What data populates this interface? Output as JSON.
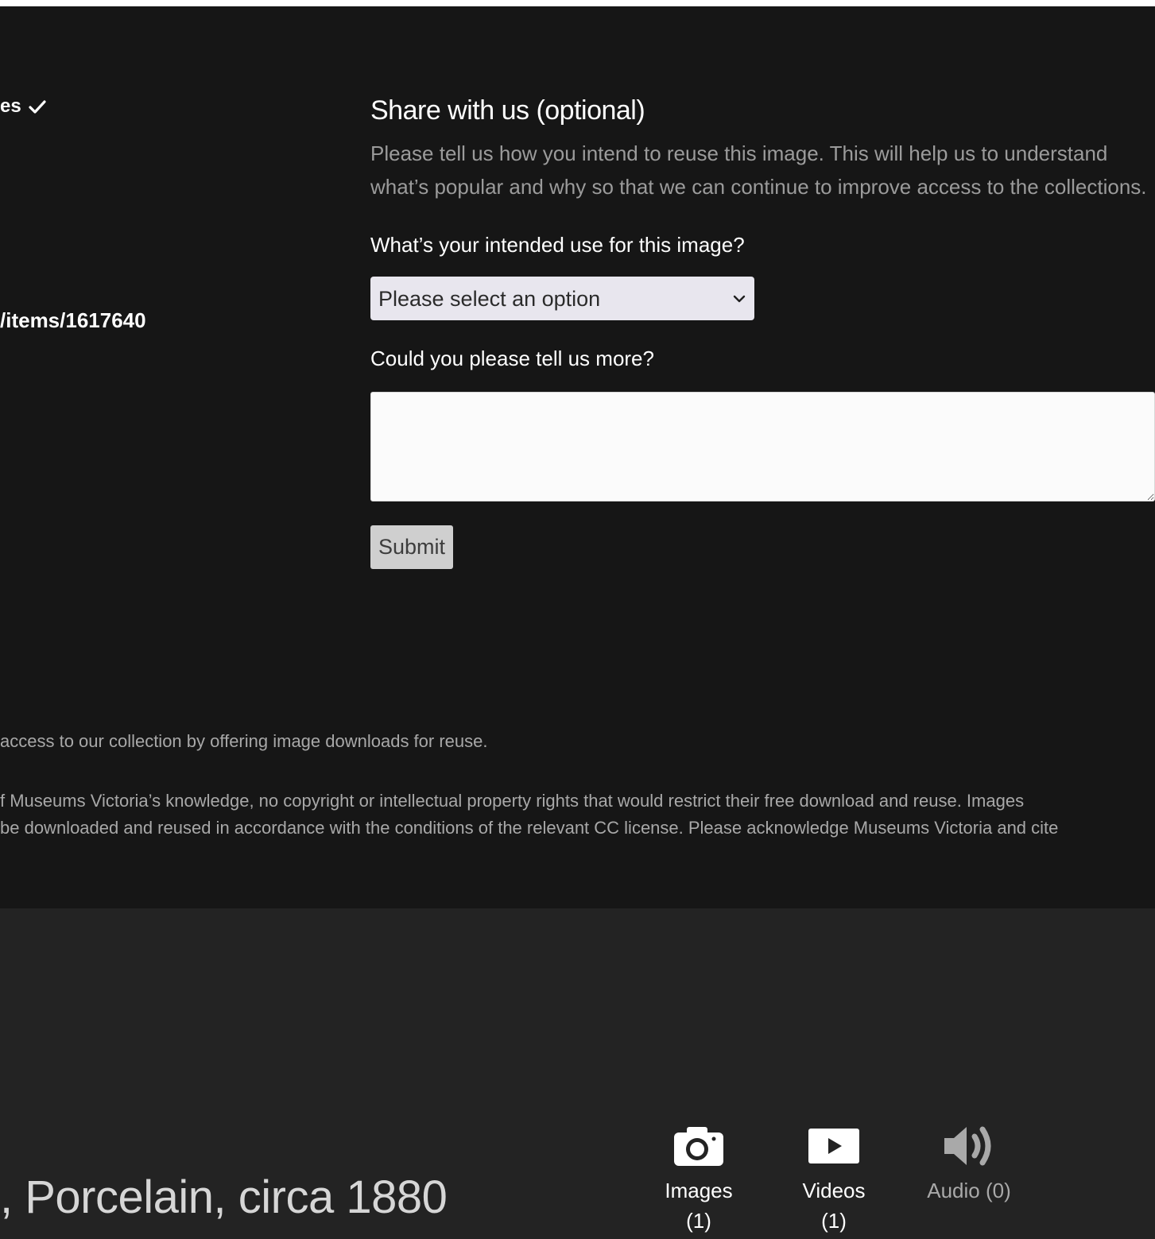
{
  "left_column": {
    "status_label": "es",
    "url_fragment": "/items/1617640"
  },
  "share": {
    "title": "Share with us (optional)",
    "description": "Please tell us how you intend to reuse this image. This will help us to understand what’s popular and why so that we can continue to improve access to the collections.",
    "use_label": "What’s your intended use for this image?",
    "select": {
      "selected": "Please select an option"
    },
    "more_label": "Could you please tell us more?",
    "textarea_value": "",
    "submit_label": "Submit"
  },
  "footnotes": {
    "line1": "access to our collection by offering image downloads for reuse.",
    "line2a": "f Museums Victoria’s knowledge, no copyright or intellectual property rights that would restrict their free download and reuse. Images",
    "line2b": "be downloaded and reused in accordance with the conditions of the relevant CC license. Please acknowledge Museums Victoria and cite"
  },
  "item": {
    "title_fragment": ", Porcelain, circa 1880"
  },
  "media": {
    "images_label": "Images",
    "images_count": "(1)",
    "videos_label": "Videos",
    "videos_count": "(1)",
    "audio_label": "Audio (0)",
    "icons": {
      "images": "camera-icon",
      "videos": "play-icon",
      "audio": "speaker-icon"
    }
  },
  "colors": {
    "dark_background": "#161616",
    "lower_background": "#232323",
    "muted_text": "#9b9b9b",
    "select_background": "#e8e6ee",
    "submit_background": "#cfcfcf"
  }
}
